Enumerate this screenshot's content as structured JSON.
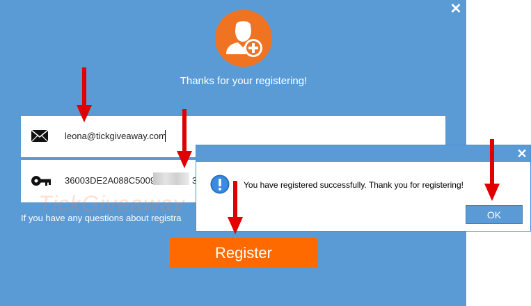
{
  "main_window": {
    "thanks_text": "Thanks for your registering!",
    "close_glyph": "✕",
    "avatar_icon": "user-add-icon",
    "email": {
      "icon": "envelope-icon",
      "value": "leona@tickgiveaway.com"
    },
    "license_key": {
      "icon": "key-icon",
      "value_visible": "36003DE2A088C5009",
      "value_suffix": "3"
    },
    "watermark": "TickGiveaway",
    "help_text": "If you have any questions about registra",
    "register_label": "Register"
  },
  "dialog": {
    "close_glyph": "✕",
    "icon": "info-icon",
    "message": "You have registered successfully. Thank you for registering!",
    "ok_label": "OK"
  },
  "colors": {
    "window_bg": "#5b9bd5",
    "accent_orange": "#ff6a00",
    "avatar_orange": "#f07322",
    "arrow_red": "#e00000"
  }
}
